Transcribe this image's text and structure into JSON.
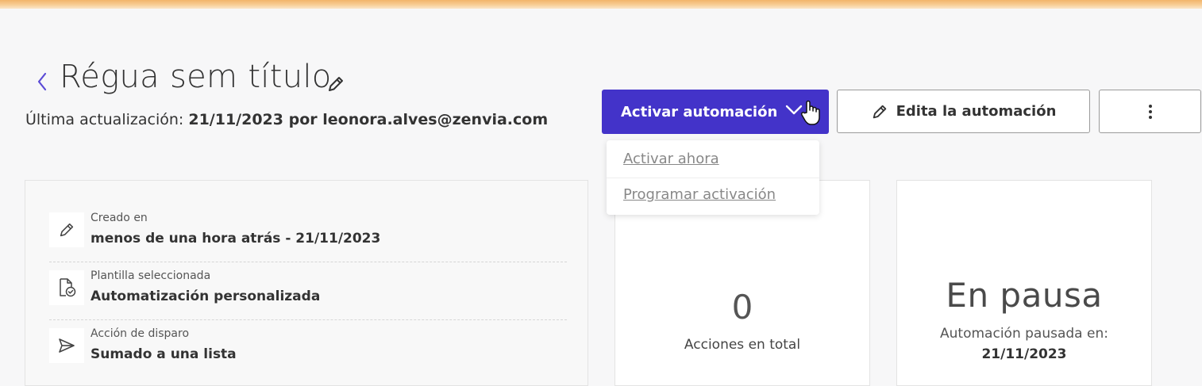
{
  "header": {
    "title": "Régua sem título",
    "updated_prefix": "Última actualización: ",
    "updated_value": "21/11/2023 por leonora.alves@zenvia.com"
  },
  "toolbar": {
    "activate_label": "Activar automación",
    "edit_label": "Edita la automación",
    "primary_color": "#4333c9"
  },
  "dropdown": {
    "items": [
      {
        "label": "Activar ahora"
      },
      {
        "label": "Programar activación"
      }
    ]
  },
  "info": {
    "rows": [
      {
        "icon": "pencil-icon",
        "label": "Creado en",
        "value": "menos de una hora atrás - 21/11/2023"
      },
      {
        "icon": "document-check-icon",
        "label": "Plantilla seleccionada",
        "value": "Automatización personalizada"
      },
      {
        "icon": "send-icon",
        "label": "Acción de disparo",
        "value": "Sumado a una lista"
      }
    ]
  },
  "stats": {
    "actions_count": "0",
    "actions_label": "Acciones en total"
  },
  "status": {
    "state": "En pausa",
    "label": "Automación pausada en:",
    "date": "21/11/2023"
  }
}
